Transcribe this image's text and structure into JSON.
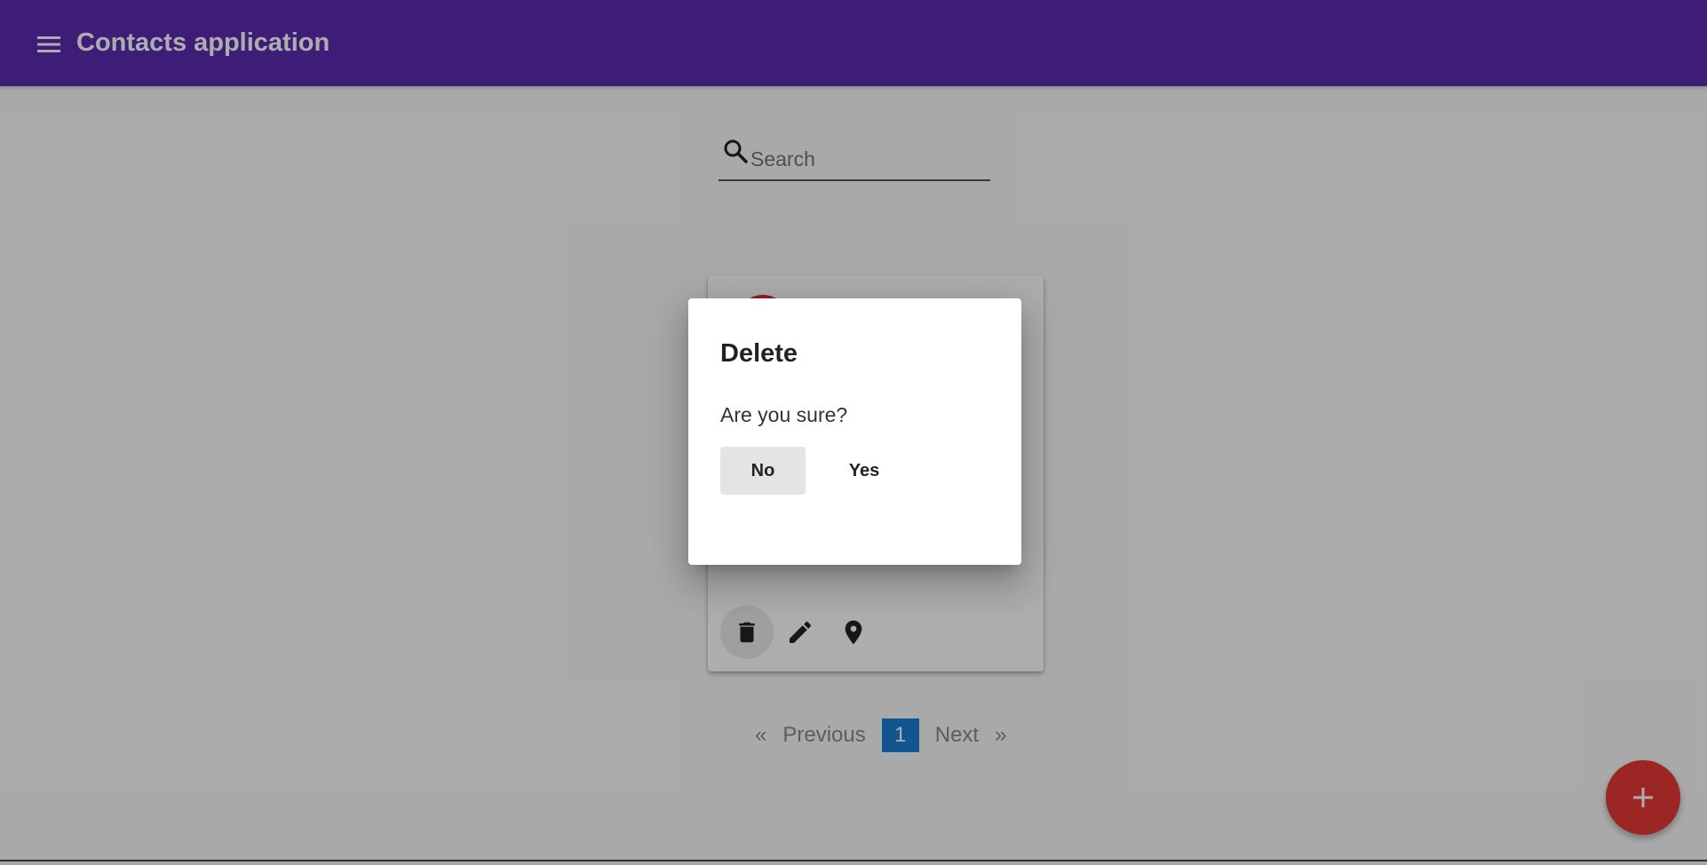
{
  "app": {
    "title": "Contacts application",
    "brand_color": "#5c2cb2",
    "menu_icon": "hamburger-menu-icon"
  },
  "search": {
    "placeholder": "Search",
    "value": "",
    "icon": "search-icon"
  },
  "card": {
    "avatar_color": "#d32f2f",
    "actions": [
      {
        "name": "delete",
        "icon": "trash-icon"
      },
      {
        "name": "edit",
        "icon": "pencil-icon"
      },
      {
        "name": "location",
        "icon": "map-pin-icon"
      }
    ]
  },
  "pagination": {
    "first_arrow": "«",
    "previous_label": "Previous",
    "current_page": "1",
    "next_label": "Next",
    "last_arrow": "»",
    "active_color": "#1a7fd6"
  },
  "fab": {
    "icon": "plus-icon",
    "color": "#e53935"
  },
  "dialog": {
    "title": "Delete",
    "message": "Are you sure?",
    "no_label": "No",
    "yes_label": "Yes"
  }
}
